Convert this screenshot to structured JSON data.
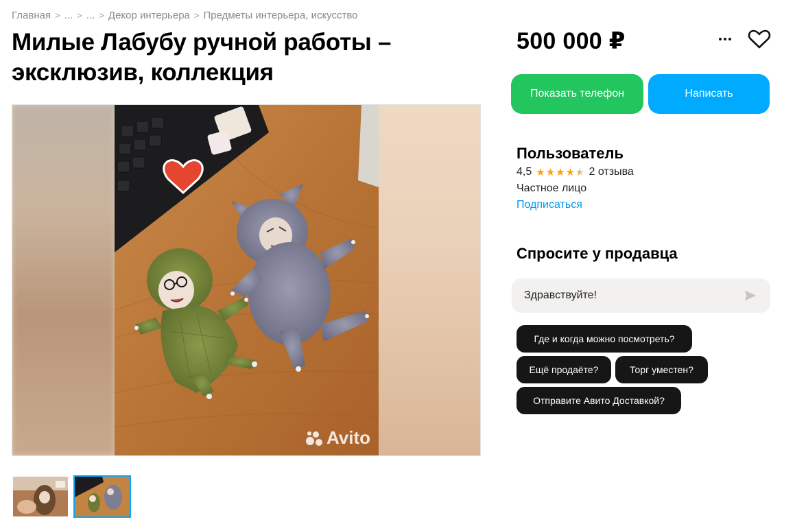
{
  "breadcrumb": {
    "items": [
      "Главная",
      "...",
      "...",
      "Декор интерьера",
      "Предметы интерьера, искусство"
    ]
  },
  "listing": {
    "title": "Милые Лабубу ручной работы – эксклюзив, коллекция",
    "price": "500 000 ₽",
    "watermark": "Avito"
  },
  "actions": {
    "show_phone": "Показать телефон",
    "write": "Написать",
    "more_icon": "more-dots-icon",
    "favorite_icon": "heart-icon"
  },
  "seller": {
    "name": "Пользователь",
    "rating": "4,5",
    "stars": 4.5,
    "reviews": "2 отзыва",
    "type": "Частное лицо",
    "subscribe": "Подписаться"
  },
  "ask": {
    "title": "Спросите у продавца",
    "message_value": "Здравствуйте!",
    "send_icon": "send-icon",
    "quick_questions": [
      "Где и когда можно посмотреть?",
      "Ещё продаёте?",
      "Торг уместен?",
      "Отправите Авито Доставкой?"
    ]
  },
  "colors": {
    "green": "#22c55e",
    "blue": "#00aaff",
    "star": "#ffa200",
    "link": "#0099ee"
  }
}
